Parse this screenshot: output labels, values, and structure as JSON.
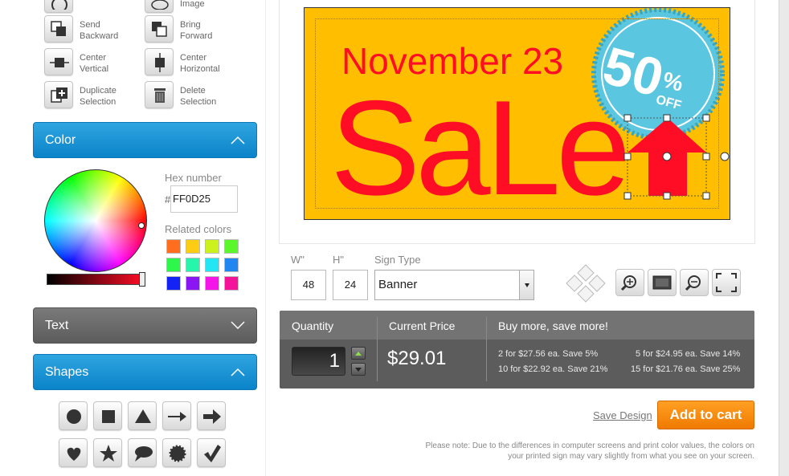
{
  "tools": {
    "image_label": "Image",
    "send_backward_line1": "Send",
    "send_backward_line2": "Backward",
    "bring_forward_line1": "Bring",
    "bring_forward_line2": "Forward",
    "center_vertical_line1": "Center",
    "center_vertical_line2": "Vertical",
    "center_horizontal_line1": "Center",
    "center_horizontal_line2": "Horizontal",
    "duplicate_line1": "Duplicate",
    "duplicate_line2": "Selection",
    "delete_line1": "Delete",
    "delete_line2": "Selection"
  },
  "color_section": {
    "title": "Color",
    "hex_label": "Hex number",
    "hash": "#",
    "hex_value": "FF0D25",
    "related_label": "Related colors",
    "related_colors": [
      "#ff6d1f",
      "#ffcc14",
      "#cdf11d",
      "#5cf72a",
      "#2cf74a",
      "#26f5ac",
      "#24e5f3",
      "#2186f0",
      "#1522f5",
      "#8a17f3",
      "#f515e8",
      "#f3149a"
    ]
  },
  "text_section": {
    "title": "Text"
  },
  "shapes_section": {
    "title": "Shapes",
    "shapes": [
      "circle-icon",
      "square-icon",
      "triangle-icon",
      "thin-arrow-icon",
      "arrow-icon",
      "heart-icon",
      "star-icon",
      "speech-bubble-icon",
      "starburst-icon",
      "checkmark-icon"
    ]
  },
  "sign": {
    "background": "#ffbe00",
    "date_text": "November 23",
    "sale_text": "SaLe",
    "badge_number": "50",
    "badge_percent": "%",
    "badge_off": "OFF",
    "accent": "#ff0d25",
    "badge_color": "#5bc6e0"
  },
  "dimensions": {
    "w_label": "W\"",
    "h_label": "H\"",
    "type_label": "Sign Type",
    "width": "48",
    "height": "24",
    "sign_type": "Banner"
  },
  "pricing": {
    "qty_label": "Quantity",
    "current_label": "Current Price",
    "buymore_label": "Buy more, save more!",
    "quantity": "1",
    "price": "$29.01",
    "deals": [
      "2 for $27.56 ea. Save 5%",
      "5 for $24.95 ea. Save 14%",
      "10 for $22.92 ea. Save 21%",
      "15 for $21.76 ea. Save 25%"
    ]
  },
  "actions": {
    "save_design": "Save Design",
    "add_to_cart": "Add to cart"
  },
  "note": "Please note: Due to the differences in computer screens and print color values, the colors on your printed sign may vary slightly from what you see on your screen."
}
